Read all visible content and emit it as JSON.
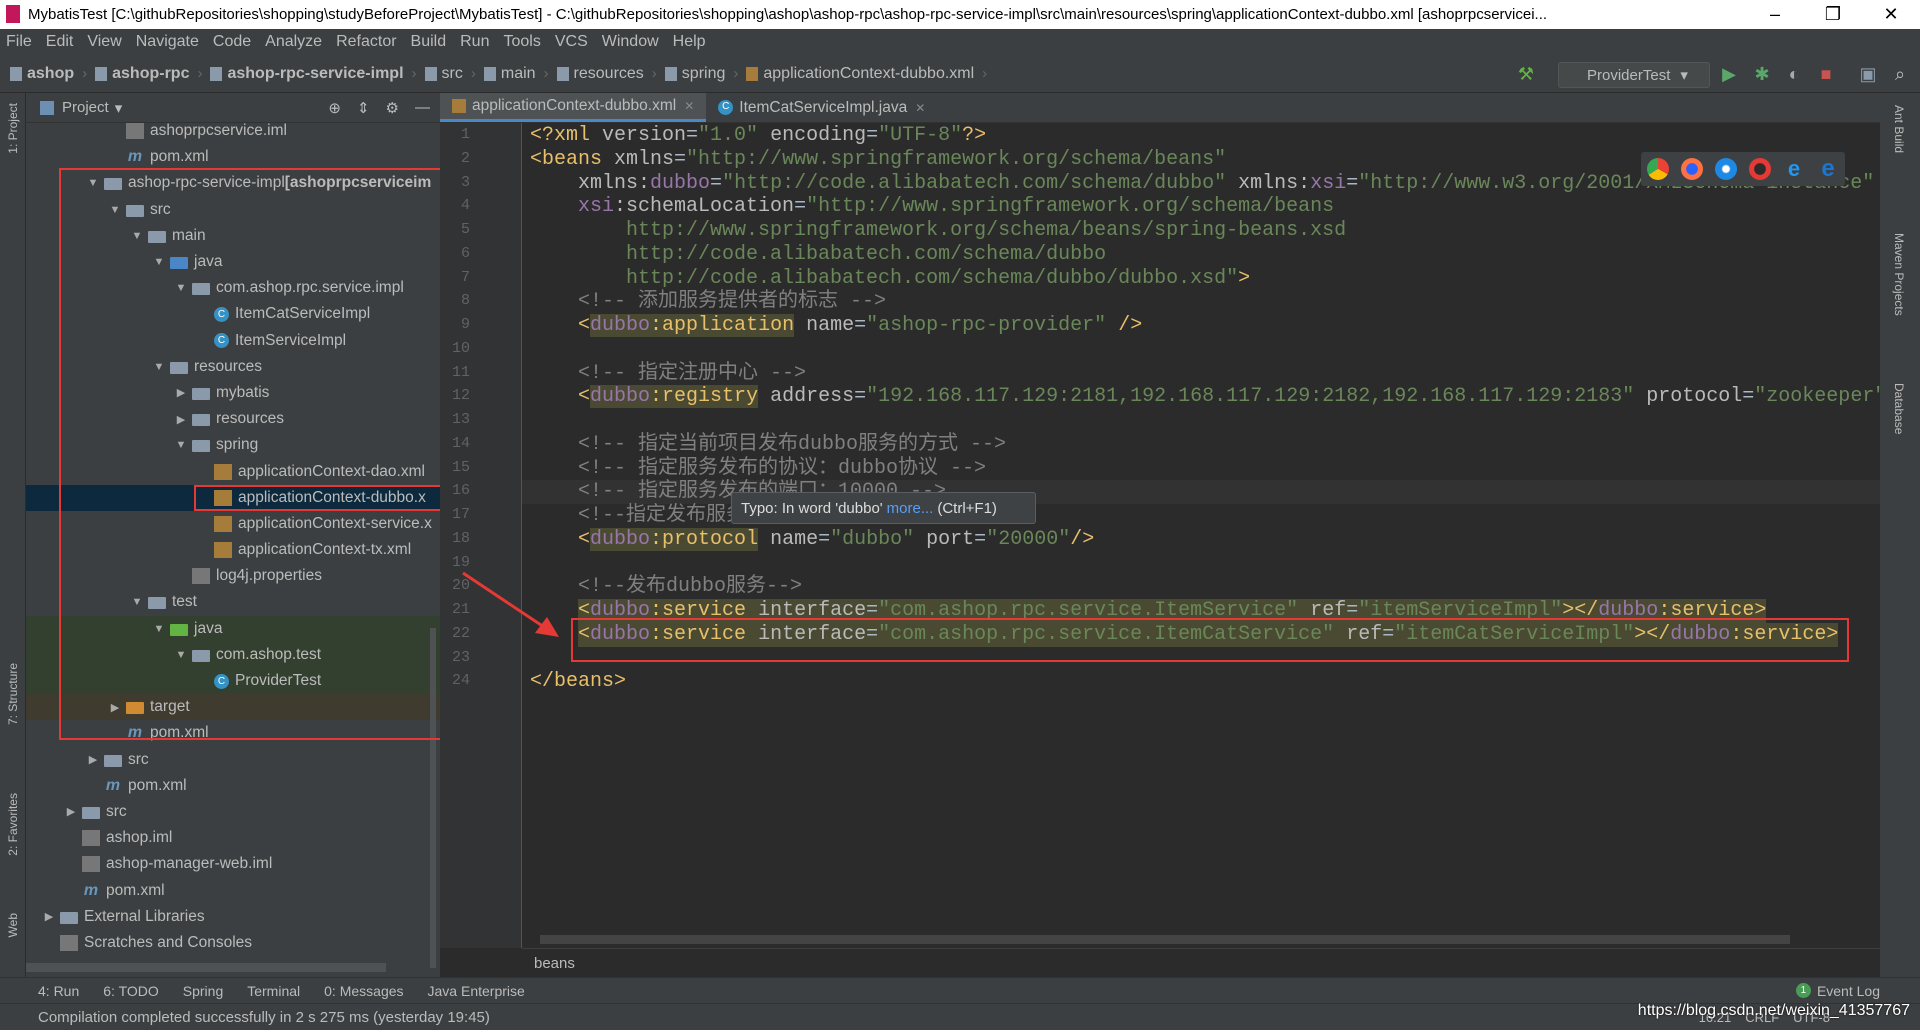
{
  "window": {
    "title": "MybatisTest [C:\\githubRepositories\\shopping\\studyBeforeProject\\MybatisTest] - C:\\githubRepositories\\shopping\\ashop\\ashop-rpc\\ashop-rpc-service-impl\\src\\main\\resources\\spring\\applicationContext-dubbo.xml [ashoprpcservicei...",
    "minimize": "–",
    "restore": "❐",
    "close": "✕"
  },
  "menu": [
    "File",
    "Edit",
    "View",
    "Navigate",
    "Code",
    "Analyze",
    "Refactor",
    "Build",
    "Run",
    "Tools",
    "VCS",
    "Window",
    "Help"
  ],
  "breadcrumb": [
    {
      "label": "ashop",
      "bold": true
    },
    {
      "label": "ashop-rpc",
      "bold": true
    },
    {
      "label": "ashop-rpc-service-impl",
      "bold": true
    },
    {
      "label": "src"
    },
    {
      "label": "main"
    },
    {
      "label": "resources"
    },
    {
      "label": "spring"
    },
    {
      "label": "applicationContext-dubbo.xml"
    }
  ],
  "run_config": "ProviderTest",
  "left_tools": [
    "1: Project",
    "7: Structure",
    "2: Favorites",
    "Web"
  ],
  "right_tools": [
    "Ant Build",
    "Maven Projects",
    "Database"
  ],
  "project": {
    "title": "Project",
    "tree": [
      {
        "label": "ashoprpcservice.iml",
        "depth": 3,
        "icon": "iml"
      },
      {
        "label": "pom.xml",
        "depth": 3,
        "icon": "pom"
      },
      {
        "label": "ashop-rpc-service-impl",
        "suffix": " [ashoprpcserviceim",
        "depth": 2,
        "icon": "module",
        "expanded": true
      },
      {
        "label": "src",
        "depth": 3,
        "icon": "folder",
        "expanded": true
      },
      {
        "label": "main",
        "depth": 4,
        "icon": "folder",
        "expanded": true
      },
      {
        "label": "java",
        "depth": 5,
        "icon": "folder-blue",
        "expanded": true
      },
      {
        "label": "com.ashop.rpc.service.impl",
        "depth": 6,
        "icon": "package",
        "expanded": true
      },
      {
        "label": "ItemCatServiceImpl",
        "depth": 7,
        "icon": "class"
      },
      {
        "label": "ItemServiceImpl",
        "depth": 7,
        "icon": "class"
      },
      {
        "label": "resources",
        "depth": 5,
        "icon": "folder",
        "expanded": true
      },
      {
        "label": "mybatis",
        "depth": 6,
        "icon": "folder",
        "expanded": false
      },
      {
        "label": "resources",
        "depth": 6,
        "icon": "folder",
        "expanded": false
      },
      {
        "label": "spring",
        "depth": 6,
        "icon": "folder",
        "expanded": true
      },
      {
        "label": "applicationContext-dao.xml",
        "depth": 7,
        "icon": "xml"
      },
      {
        "label": "applicationContext-dubbo.x",
        "depth": 7,
        "icon": "xml",
        "selected": true
      },
      {
        "label": "applicationContext-service.x",
        "depth": 7,
        "icon": "xml"
      },
      {
        "label": "applicationContext-tx.xml",
        "depth": 7,
        "icon": "xml"
      },
      {
        "label": "log4j.properties",
        "depth": 6,
        "icon": "properties"
      },
      {
        "label": "test",
        "depth": 4,
        "icon": "folder",
        "expanded": true
      },
      {
        "label": "java",
        "depth": 5,
        "icon": "folder-green",
        "expanded": true,
        "test": true
      },
      {
        "label": "com.ashop.test",
        "depth": 6,
        "icon": "package",
        "expanded": true,
        "test": true
      },
      {
        "label": "ProviderTest",
        "depth": 7,
        "icon": "class",
        "test": true
      },
      {
        "label": "target",
        "depth": 3,
        "icon": "folder-orange",
        "expanded": false,
        "target": true
      },
      {
        "label": "pom.xml",
        "depth": 3,
        "icon": "pom"
      },
      {
        "label": "src",
        "depth": 2,
        "icon": "folder",
        "expanded": false
      },
      {
        "label": "pom.xml",
        "depth": 2,
        "icon": "pom"
      },
      {
        "label": "src",
        "depth": 1,
        "icon": "folder",
        "expanded": false
      },
      {
        "label": "ashop.iml",
        "depth": 1,
        "icon": "iml"
      },
      {
        "label": "ashop-manager-web.iml",
        "depth": 1,
        "icon": "iml"
      },
      {
        "label": "pom.xml",
        "depth": 1,
        "icon": "pom"
      },
      {
        "label": "External Libraries",
        "depth": 0,
        "icon": "libraries",
        "expanded": false
      },
      {
        "label": "Scratches and Consoles",
        "depth": 0,
        "icon": "scratches"
      }
    ]
  },
  "tabs": [
    {
      "label": "applicationContext-dubbo.xml",
      "active": true,
      "icon": "xml"
    },
    {
      "label": "ItemCatServiceImpl.java",
      "icon": "class"
    }
  ],
  "editor": {
    "current_line": 16,
    "lines": [
      [
        [
          "b",
          "<?xml "
        ],
        [
          "a",
          "version"
        ],
        [
          "p",
          "="
        ],
        [
          "v",
          "\"1.0\""
        ],
        [
          "p",
          " "
        ],
        [
          "a",
          "encoding"
        ],
        [
          "p",
          "="
        ],
        [
          "v",
          "\"UTF-8\""
        ],
        [
          "b",
          "?>"
        ]
      ],
      [
        [
          "b",
          "<beans "
        ],
        [
          "a",
          "xmlns"
        ],
        [
          "p",
          "="
        ],
        [
          "v",
          "\"http://www.springframework.org/schema/beans\""
        ]
      ],
      [
        [
          "p",
          "    "
        ],
        [
          "a",
          "xmlns:"
        ],
        [
          "n",
          "dubbo"
        ],
        [
          "p",
          "="
        ],
        [
          "v",
          "\"http://code.alibabatech.com/schema/dubbo\""
        ],
        [
          "p",
          " "
        ],
        [
          "a",
          "xmlns:"
        ],
        [
          "n",
          "xsi"
        ],
        [
          "p",
          "="
        ],
        [
          "v",
          "\"http://www.w3.org/2001/XMLSchema-instance\""
        ]
      ],
      [
        [
          "p",
          "    "
        ],
        [
          "n",
          "xsi"
        ],
        [
          "a",
          ":schemaLocation"
        ],
        [
          "p",
          "="
        ],
        [
          "v",
          "\"http://www.springframework.org/schema/beans"
        ]
      ],
      [
        [
          "v",
          "        http://www.springframework.org/schema/beans/spring-beans.xsd"
        ]
      ],
      [
        [
          "v",
          "        http://code.alibabatech.com/schema/dubbo"
        ]
      ],
      [
        [
          "v",
          "        http://code.alibabatech.com/schema/dubbo/dubbo.xsd\""
        ],
        [
          "b",
          ">"
        ]
      ],
      [
        [
          "c",
          "    <!-- 添加服务提供者的标志 -->"
        ]
      ],
      [
        [
          "p",
          "    "
        ],
        [
          "b",
          "<"
        ],
        [
          "nh",
          "dubbo"
        ],
        [
          "bh",
          ":application"
        ],
        [
          "p",
          " "
        ],
        [
          "a",
          "name"
        ],
        [
          "p",
          "="
        ],
        [
          "v",
          "\"ashop-rpc-provider\""
        ],
        [
          "p",
          " "
        ],
        [
          "b",
          "/>"
        ]
      ],
      [],
      [
        [
          "c",
          "    <!-- 指定注册中心 -->"
        ]
      ],
      [
        [
          "p",
          "    "
        ],
        [
          "b",
          "<"
        ],
        [
          "nh",
          "dubbo"
        ],
        [
          "bh",
          ":registry"
        ],
        [
          "p",
          " "
        ],
        [
          "a",
          "address"
        ],
        [
          "p",
          "="
        ],
        [
          "v",
          "\"192.168.117.129:2181,192.168.117.129:2182,192.168.117.129:2183\""
        ],
        [
          "p",
          " "
        ],
        [
          "a",
          "protocol"
        ],
        [
          "p",
          "="
        ],
        [
          "v",
          "\"zookeeper\""
        ],
        [
          "p",
          " "
        ],
        [
          "b",
          "/>"
        ]
      ],
      [],
      [
        [
          "c",
          "    <!-- 指定当前项目发布dubbo服务的方式 -->"
        ]
      ],
      [
        [
          "c",
          "    <!-- 指定服务发布的协议：dubbo协议 -->"
        ]
      ],
      [
        [
          "c",
          "    <!-- 指定服务发布的端口：10000 -->"
        ]
      ],
      [
        [
          "c",
          "    <!--指定发布服务的端口-->"
        ]
      ],
      [
        [
          "p",
          "    "
        ],
        [
          "b",
          "<"
        ],
        [
          "nh",
          "dubbo"
        ],
        [
          "bh",
          ":protocol"
        ],
        [
          "p",
          " "
        ],
        [
          "a",
          "name"
        ],
        [
          "p",
          "="
        ],
        [
          "v",
          "\"dubbo\""
        ],
        [
          "p",
          " "
        ],
        [
          "a",
          "port"
        ],
        [
          "p",
          "="
        ],
        [
          "v",
          "\"20000\""
        ],
        [
          "b",
          "/>"
        ]
      ],
      [],
      [
        [
          "c",
          "    <!--发布dubbo服务-->"
        ]
      ],
      [
        [
          "p",
          "    "
        ],
        [
          "b",
          "<"
        ],
        [
          "n",
          "dubbo"
        ],
        [
          "b",
          ":service "
        ],
        [
          "a",
          "interface"
        ],
        [
          "p",
          "="
        ],
        [
          "v",
          "\"com.ashop.rpc.service.ItemService\""
        ],
        [
          "p",
          " "
        ],
        [
          "a",
          "ref"
        ],
        [
          "p",
          "="
        ],
        [
          "v",
          "\"itemServiceImpl\""
        ],
        [
          "b",
          "></"
        ],
        [
          "n",
          "dubbo"
        ],
        [
          "b",
          ":service>"
        ]
      ],
      [
        [
          "p",
          "    "
        ],
        [
          "b",
          "<"
        ],
        [
          "n",
          "dubbo"
        ],
        [
          "b",
          ":service "
        ],
        [
          "a",
          "interface"
        ],
        [
          "p",
          "="
        ],
        [
          "v",
          "\"com.ashop.rpc.service.ItemCatService\""
        ],
        [
          "p",
          " "
        ],
        [
          "a",
          "ref"
        ],
        [
          "p",
          "="
        ],
        [
          "v",
          "\"itemCatServiceImpl\""
        ],
        [
          "b",
          "></"
        ],
        [
          "n",
          "dubbo"
        ],
        [
          "b",
          ":service>"
        ]
      ],
      [],
      [
        [
          "b",
          "</beans>"
        ]
      ]
    ],
    "highlighted_lines": [
      21,
      22
    ]
  },
  "tooltip": {
    "text": "Typo: In word 'dubbo'",
    "link": "more...",
    "shortcut": "(Ctrl+F1)"
  },
  "editor_breadcrumb": "beans",
  "bottom_tools": [
    "4: Run",
    "6: TODO",
    "Spring",
    "Terminal",
    "0: Messages",
    "Java Enterprise"
  ],
  "event_log": "Event Log",
  "event_count": "1",
  "status": {
    "message": "Compilation completed successfully in 2 s 275 ms (yesterday 19:45)",
    "position": "16:21",
    "line_sep": "CRLF",
    "encoding": "UTF-8"
  },
  "watermark": "https://blog.csdn.net/weixin_41357767",
  "colors": {
    "tag": "#e8bf6a",
    "attr": "#bababa",
    "namespace": "#9876aa",
    "value": "#6a8759",
    "comment": "#808080",
    "annotation_red": "#e53935",
    "selection": "#0d293e"
  }
}
